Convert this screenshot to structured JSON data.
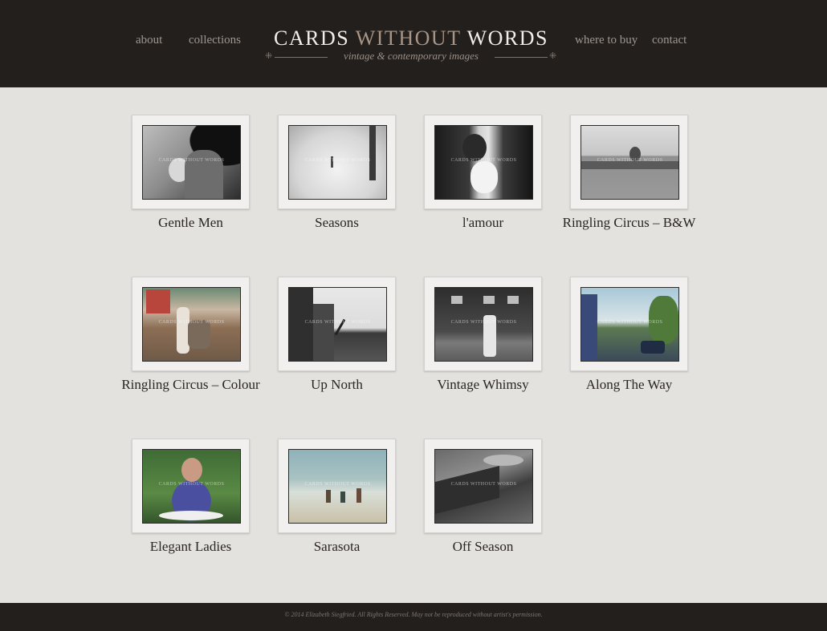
{
  "nav": {
    "about": "about",
    "collections": "collections",
    "where_to_buy": "where to buy",
    "contact": "contact"
  },
  "logo": {
    "title_part1": "CARDS",
    "title_part2": "WITHOUT",
    "title_part3": "WORDS",
    "tagline": "vintage & contemporary images",
    "ornament": "⁜"
  },
  "watermark": "CARDS WITHOUT WORDS",
  "collections": [
    {
      "title": "Gentle Men"
    },
    {
      "title": "Seasons"
    },
    {
      "title": "l'amour"
    },
    {
      "title": "Ringling Circus – B&W"
    },
    {
      "title": "Ringling Circus – Colour"
    },
    {
      "title": "Up North"
    },
    {
      "title": "Vintage Whimsy"
    },
    {
      "title": "Along The Way"
    },
    {
      "title": "Elegant Ladies"
    },
    {
      "title": "Sarasota"
    },
    {
      "title": "Off Season"
    }
  ],
  "footer": {
    "copyright": "© 2014 Elizabeth Siegfried. All Rights Reserved. May not be reproduced without artist's permission."
  },
  "colors": {
    "header_bg": "#231f1d",
    "page_bg": "#e4e2df",
    "logo_accent": "#a89585",
    "nav_text": "#9e9790"
  }
}
